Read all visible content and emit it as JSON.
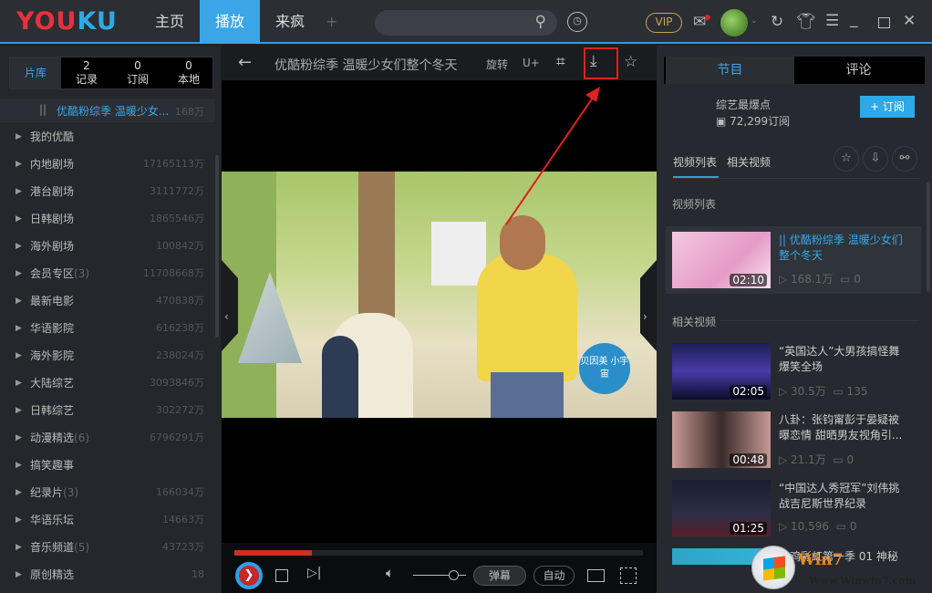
{
  "app": {
    "logo": "YOUKU",
    "nav": [
      "主页",
      "播放",
      "来疯"
    ],
    "add": "+",
    "vip": "VIP",
    "icons": [
      "search-icon",
      "history-icon",
      "mail-icon",
      "refresh-icon",
      "skin-icon",
      "menu-icon",
      "minimize-icon",
      "maximize-icon",
      "close-icon"
    ]
  },
  "sidebar": {
    "tabs": [
      {
        "label": "片库",
        "count": ""
      },
      {
        "label": "记录",
        "count": "2"
      },
      {
        "label": "订阅",
        "count": "0"
      },
      {
        "label": "本地",
        "count": "0"
      }
    ],
    "now_playing": {
      "icon": "||",
      "title": "优酷粉综季 温暖少女...",
      "count": "168万"
    },
    "items": [
      {
        "label": "我的优酷",
        "badge": "",
        "count": ""
      },
      {
        "label": "内地剧场",
        "badge": "",
        "count": "17165113万"
      },
      {
        "label": "港台剧场",
        "badge": "",
        "count": "3111772万"
      },
      {
        "label": "日韩剧场",
        "badge": "",
        "count": "1865546万"
      },
      {
        "label": "海外剧场",
        "badge": "",
        "count": "100842万"
      },
      {
        "label": "会员专区",
        "badge": "(3)",
        "count": "11708668万"
      },
      {
        "label": "最新电影",
        "badge": "",
        "count": "470838万"
      },
      {
        "label": "华语影院",
        "badge": "",
        "count": "616238万"
      },
      {
        "label": "海外影院",
        "badge": "",
        "count": "238024万"
      },
      {
        "label": "大陆综艺",
        "badge": "",
        "count": "3093846万"
      },
      {
        "label": "日韩综艺",
        "badge": "",
        "count": "302272万"
      },
      {
        "label": "动漫精选",
        "badge": "(6)",
        "count": "6796291万"
      },
      {
        "label": "搞笑趣事",
        "badge": "",
        "count": ""
      },
      {
        "label": "纪录片",
        "badge": "(3)",
        "count": "166034万"
      },
      {
        "label": "华语乐坛",
        "badge": "",
        "count": "14663万"
      },
      {
        "label": "音乐频道",
        "badge": "(5)",
        "count": "43723万"
      },
      {
        "label": "原创精选",
        "badge": "",
        "count": "18"
      }
    ]
  },
  "player": {
    "title": "优酷粉综季 温暖少女们整个冬天",
    "rotate": "旋转",
    "uplus": "U+",
    "video_badge": "贝因美 小宇宙",
    "progress": 0.19,
    "volume": 0.75,
    "danmu": "弹幕",
    "quality": "自动"
  },
  "right": {
    "tabs": [
      "节目",
      "评论"
    ],
    "channel": "综艺最爆点",
    "subs": "72,299订阅",
    "subscribe": "+ 订阅",
    "subtabs": [
      "视频列表",
      "相关视频"
    ],
    "section1": "视频列表",
    "section2": "相关视频",
    "current": {
      "title": "|| 优酷粉综季 温暖少女们整个冬天",
      "duration": "02:10",
      "views": "▷ 168.1万",
      "comments": "▭ 0"
    },
    "related": [
      {
        "title": "“英国达人”大男孩搞怪舞爆笑全场",
        "duration": "02:05",
        "views": "▷ 30.5万",
        "comments": "▭ 135"
      },
      {
        "title": "八卦：张钧甯彭于晏疑被曝恋情 甜晒男友视角引...",
        "duration": "00:48",
        "views": "▷ 21.1万",
        "comments": "▭ 0"
      },
      {
        "title": "“中国达人秀冠军”刘伟挑战吉尼斯世界纪录",
        "duration": "01:25",
        "views": "▷ 10,596",
        "comments": "▭ 0"
      },
      {
        "title": "小鸡彩虹第一季 01 神秘",
        "duration": "",
        "views": "",
        "comments": ""
      }
    ]
  },
  "watermark": {
    "brand": "Win7",
    "url": "Www.Winwin7.com"
  },
  "colors": {
    "accent": "#2f9be0",
    "highlight": "#e02020"
  }
}
